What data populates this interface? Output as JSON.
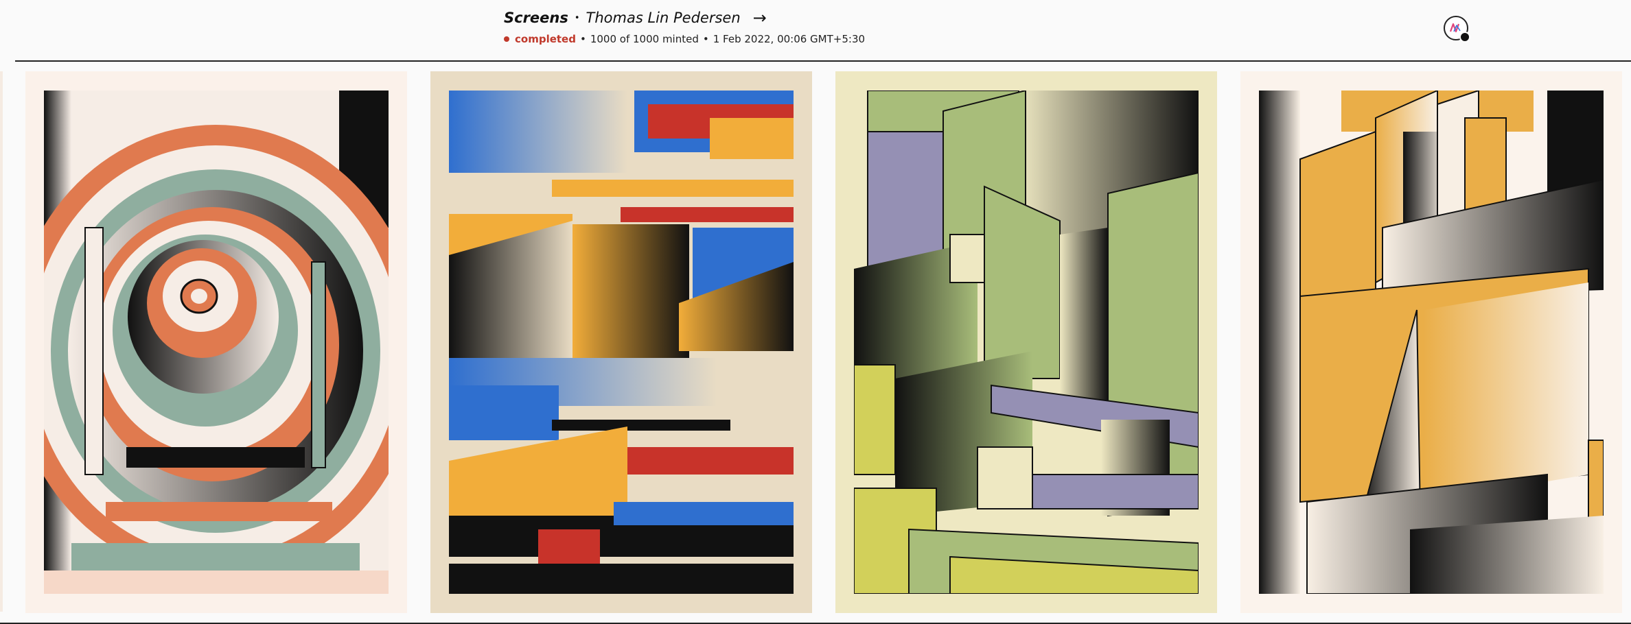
{
  "project": {
    "title": "Screens",
    "separator": "•",
    "artist": "Thomas Lin Pedersen",
    "arrow": "→"
  },
  "meta": {
    "status": "completed",
    "minted": "1000 of 1000 minted",
    "date": "1 Feb 2022, 00:06 GMT+5:30",
    "separator": "•",
    "status_color": "#c0392b"
  },
  "user_menu": {
    "icon": "wallet-avatar-icon"
  },
  "artworks": [
    {
      "name": "artwork-spiral-teal-orange",
      "palette": [
        "#f6ede6",
        "#e07a4f",
        "#8fae9f",
        "#111111"
      ]
    },
    {
      "name": "artwork-blue-yellow-red",
      "palette": [
        "#e9dcc4",
        "#2f6fcf",
        "#f2ad3a",
        "#c8332a",
        "#111111"
      ]
    },
    {
      "name": "artwork-green-lilac",
      "palette": [
        "#eee8c2",
        "#a8bd7a",
        "#9590b4",
        "#d2d05a",
        "#111111"
      ]
    },
    {
      "name": "artwork-gold-cream",
      "palette": [
        "#fbf3ec",
        "#eaae48",
        "#f8efe4",
        "#111111"
      ]
    }
  ]
}
